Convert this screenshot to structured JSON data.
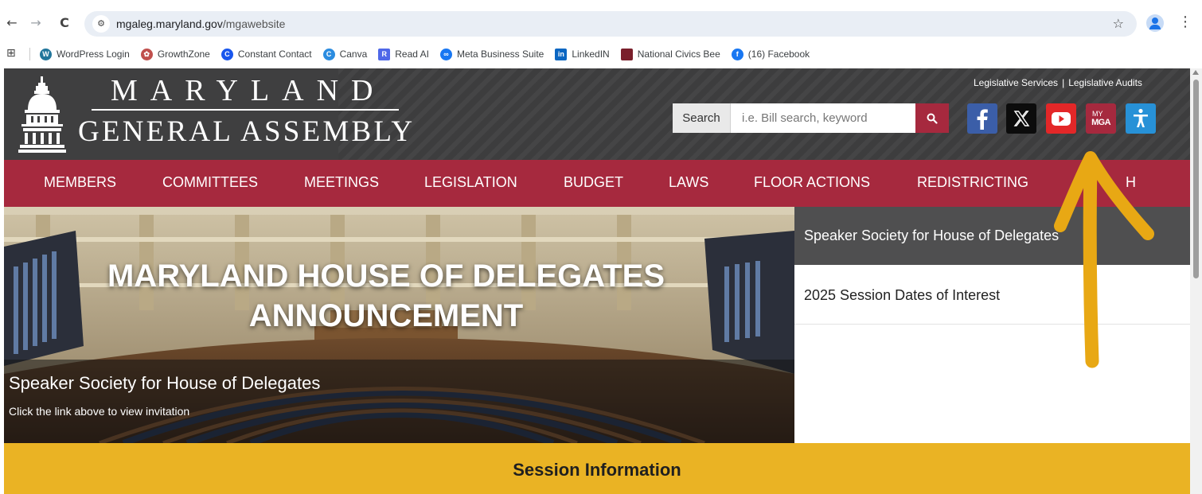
{
  "browser": {
    "back_glyph": "←",
    "forward_glyph": "→",
    "reload_glyph": "C",
    "site_info_glyph": "⚙",
    "url_host": "mgaleg.maryland.gov",
    "url_path": "/mgawebsite",
    "star_glyph": "☆",
    "kebab_glyph": "⋮",
    "apps_glyph": "⊞",
    "bookmarks": [
      {
        "label": "WordPress Login",
        "icon": "wordpress-icon",
        "color": "#21759b",
        "glyph": "W"
      },
      {
        "label": "GrowthZone",
        "icon": "growthzone-icon",
        "color": "#c0504d",
        "glyph": "✿"
      },
      {
        "label": "Constant Contact",
        "icon": "constant-contact-icon",
        "color": "#1856ed",
        "glyph": "C"
      },
      {
        "label": "Canva",
        "icon": "canva-icon",
        "color": "#2b8ce0",
        "glyph": "C"
      },
      {
        "label": "Read AI",
        "icon": "read-ai-icon",
        "color": "#4f68e8",
        "glyph": "R"
      },
      {
        "label": "Meta Business Suite",
        "icon": "meta-icon",
        "color": "#1877f2",
        "glyph": "∞"
      },
      {
        "label": "LinkedIN",
        "icon": "linkedin-icon",
        "color": "#0a66c2",
        "glyph": "in"
      },
      {
        "label": "National Civics Bee",
        "icon": "civics-bee-icon",
        "color": "#7a1f2b",
        "glyph": ""
      },
      {
        "label": "(16) Facebook",
        "icon": "facebook-icon",
        "color": "#1877f2",
        "glyph": "f"
      }
    ]
  },
  "header": {
    "logo_line1": "MARYLAND",
    "logo_line2": "GENERAL ASSEMBLY",
    "util_links": [
      "Legislative Services",
      "Legislative Audits"
    ],
    "util_sep": "|",
    "search_label": "Search",
    "search_placeholder": "i.e. Bill search, keyword",
    "search_glyph": "🔍",
    "social": [
      {
        "name": "facebook",
        "icon": "facebook-icon",
        "color": "#3b5ea8"
      },
      {
        "name": "x",
        "icon": "x-icon",
        "color": "#0c0c0c"
      },
      {
        "name": "youtube",
        "icon": "youtube-icon",
        "color": "#e32728"
      },
      {
        "name": "my-mga",
        "icon": "my-mga-icon",
        "color": "#a6293e",
        "text_top": "MY",
        "text_bottom": "MGA"
      },
      {
        "name": "accessibility",
        "icon": "accessibility-icon",
        "color": "#2791d7"
      }
    ]
  },
  "nav": {
    "items": [
      "MEMBERS",
      "COMMITTEES",
      "MEETINGS",
      "LEGISLATION",
      "BUDGET",
      "LAWS",
      "FLOOR ACTIONS",
      "REDISTRICTING",
      "H"
    ]
  },
  "hero": {
    "title": "MARYLAND HOUSE OF DELEGATES ANNOUNCEMENT",
    "caption_title": "Speaker Society for House of Delegates",
    "caption_sub": "Click the link above to view invitation"
  },
  "side_list": {
    "items": [
      "Speaker Society for House of Delegates",
      "2025 Session Dates of Interest"
    ]
  },
  "session": {
    "title": "Session Information"
  },
  "colors": {
    "brand_red": "#a6293e",
    "header_dark": "#3f3f40",
    "session_gold": "#eab324",
    "annotation_gold": "#e8a814"
  }
}
